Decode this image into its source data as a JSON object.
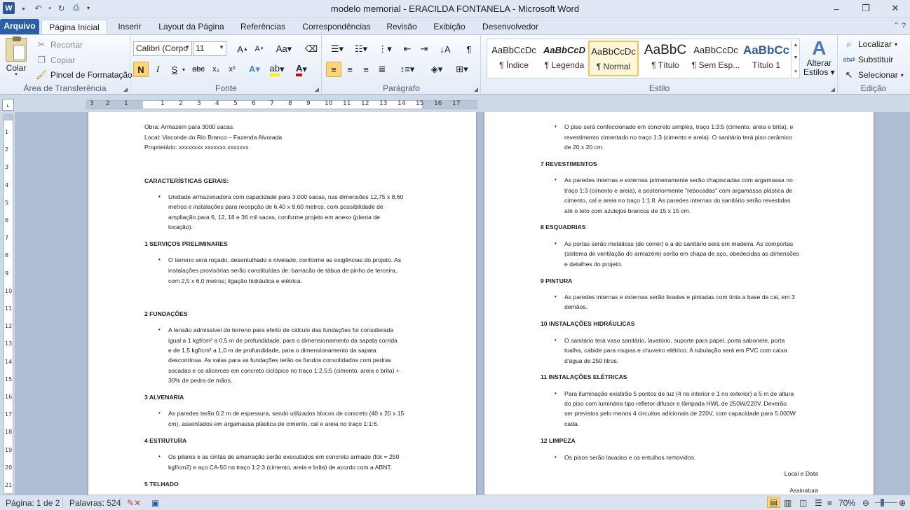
{
  "window": {
    "title": "modelo memorial - ERACILDA FONTANELA  -  Microsoft Word",
    "min": "–",
    "max": "❐",
    "close": "✕"
  },
  "tabs": [
    "Arquivo",
    "Página Inicial",
    "Inserir",
    "Layout da Página",
    "Referências",
    "Correspondências",
    "Revisão",
    "Exibição",
    "Desenvolvedor"
  ],
  "clipboard": {
    "label": "Área de Transferência",
    "paste": "Colar",
    "cut": "Recortar",
    "copy": "Copiar",
    "format_painter": "Pincel de Formatação"
  },
  "font": {
    "label": "Fonte",
    "family": "Calibri (Corpo",
    "size": "11"
  },
  "paragraph": {
    "label": "Parágrafo"
  },
  "styles": {
    "label": "Estilo",
    "items": [
      {
        "preview": "AaBbCcDc",
        "name": "¶ Índice"
      },
      {
        "preview": "AaBbCcD",
        "name": "¶ Legenda"
      },
      {
        "preview": "AaBbCcDc",
        "name": "¶ Normal"
      },
      {
        "preview": "AaBbC",
        "name": "¶ Título"
      },
      {
        "preview": "AaBbCcDc",
        "name": "¶ Sem Esp..."
      },
      {
        "preview": "AaBbCc",
        "name": "Título 1"
      }
    ],
    "change": "Alterar",
    "change2": "Estilos"
  },
  "editing": {
    "label": "Edição",
    "find": "Localizar",
    "replace": "Substituir",
    "select": "Selecionar"
  },
  "ruler_numbers": [
    "3",
    "2",
    "1",
    "1",
    "2",
    "3",
    "4",
    "5",
    "6",
    "7",
    "8",
    "9",
    "10",
    "11",
    "12",
    "13",
    "14",
    "15",
    "16",
    "17"
  ],
  "vruler_numbers": [
    "1",
    "2",
    "3",
    "4",
    "5",
    "6",
    "7",
    "8",
    "9",
    "10",
    "11",
    "12",
    "13",
    "14",
    "15",
    "16",
    "17",
    "18",
    "19",
    "20",
    "21"
  ],
  "page1": [
    {
      "t": "Obra: Armazém para 3000 sacas."
    },
    {
      "t": "Local: Visconde do Rio Branco – Fazenda Alvorada"
    },
    {
      "t": "Proprietário: xxxxxxxx  xxxxxxx  xxxxxxx"
    },
    {
      "t": "CARACTERÍSTICAS GERAIS:"
    },
    {
      "t": "Unidade armazenadora com capacidade para 3.000 sacas, nas dimensões  12,75 x 8,60"
    },
    {
      "t": "metros e instalações  para recepção de 6,40 x 8,60 metros, com possibilidade  de"
    },
    {
      "t": "ampliação para 6, 12, 18 e 36 mil sacas, conforme projeto em anexo (planta de"
    },
    {
      "t": "locação)."
    },
    {
      "t": "1 SERVIÇOS PRELIMINARES"
    },
    {
      "t": "O terreno será roçado, desentulhado  e nivelado,  conforme as exigências do projeto. As"
    },
    {
      "t": "instalações  provisórias serão constituídas  de: barracão de tábua de pinho de terceira,"
    },
    {
      "t": "com 2,5 x 6,0 metros; ligação hidráulica  e elétrica."
    },
    {
      "t": "2 FUNDAÇÕES"
    },
    {
      "t": "A tensão admissível do terreno para efeito de cálculo das fundações foi considerada"
    },
    {
      "t": "igual a 1 kgf/cm² a 0,5 m de profundidade,  para o dimensionamento  da sapata corrida"
    },
    {
      "t": "e de 1,5 kgf/cm² a 1,0 m de profundidade,  para o dimensionamento  da sapata"
    },
    {
      "t": "descontínua.  As valas para as fundações  terão os fundos consolidados  com pedras"
    },
    {
      "t": "socadas e os alicerces  em concreto ciclópico  no traço 1:2,5:5 (cimento, areia e brita) +"
    },
    {
      "t": "30% de pedra de mãos."
    },
    {
      "t": "3 ALVENARIA"
    },
    {
      "t": "As paredes terão 0,2 m de espessura, sendo utilizados  blocos de concreto (40 x 20 x 15"
    },
    {
      "t": "cm), assentados em argamassa plástica de cimento,  cal e areia no traço 1:1:6."
    },
    {
      "t": "4 ESTRUTURA"
    },
    {
      "t": "Os pilares e as cintas de amarração serão executados  em concreto armado (fck = 250"
    },
    {
      "t": "kgf/cm2) e aço CA-50 no traço 1:2:3 (cimento,  areia e brita) de acordo com a ABNT."
    },
    {
      "t": "5 TELHADO"
    }
  ],
  "page2": [
    {
      "t": "O piso será confeccionado  em concreto simples, traço 1:3:5 (cimento,  areia e brita), e"
    },
    {
      "t": "revestimento cimentado  no traço 1:3 (cimento  e areia). O sanitário terá piso cerâmico"
    },
    {
      "t": "de 20 x 20 cm."
    },
    {
      "t": "7 REVESTIMENTOS"
    },
    {
      "t": "As paredes internas e externas primeiramente  serão chapiscadas com argamassa no"
    },
    {
      "t": "traço 1:3 (cimento  e areia), e posteriormente  \"rebocadas\" com argamassa plástica de"
    },
    {
      "t": "cimento,  cal e areia no traço 1:1:8. As paredes internas  do sanitário serão revestidas"
    },
    {
      "t": "até o teto com azulejos brancos de 15 x 15 cm."
    },
    {
      "t": "8 ESQUADRIAS"
    },
    {
      "t": "As portas serão metálicas  (de correr) e a do sanitário será em madeira. As comportas"
    },
    {
      "t": "(sistema de ventilação  do armazém) serão em chapa de aço, obedecidas as dimensões"
    },
    {
      "t": "e detalhes  do projeto."
    },
    {
      "t": "9 PINTURA"
    },
    {
      "t": "As paredes internas e externas serão lixadas e pintadas com tinta  a base de cal, em 3"
    },
    {
      "t": "demãos."
    },
    {
      "t": "10 INSTALAÇÕES HIDRÁULICAS"
    },
    {
      "t": "O sanitário terá vaso sanitário, lavatório, suporte para papel, porta sabonete, porta"
    },
    {
      "t": "toalha,  cabide  para roupas e chuveiro elétrico.  A tubulação  será em PVC com  caixa"
    },
    {
      "t": "d'água de 250 litros."
    },
    {
      "t": "11 INSTALAÇÕES ELÉTRICAS"
    },
    {
      "t": "Para iluminação  existirão 5 pontos de luz (4 no interior e 1 no exterior)  a 5 m de altura"
    },
    {
      "t": "do piso com luminária tipo refletor-difusor  e lâmpada HWL de 250W/220V. Deverão"
    },
    {
      "t": "ser previstos pelo menos 4 circuitos  adicionais  de 220V, com  capacidade  para 5.000W"
    },
    {
      "t": "cada."
    },
    {
      "t": "12 LIMPEZA"
    },
    {
      "t": "Os pisos  serão lavados e os entulhos  removidos."
    },
    {
      "t": "Local  e Data"
    },
    {
      "t": "Assinatura"
    }
  ],
  "status": {
    "page": "Página: 1 de 2",
    "words": "Palavras: 524",
    "zoom": "70%"
  }
}
